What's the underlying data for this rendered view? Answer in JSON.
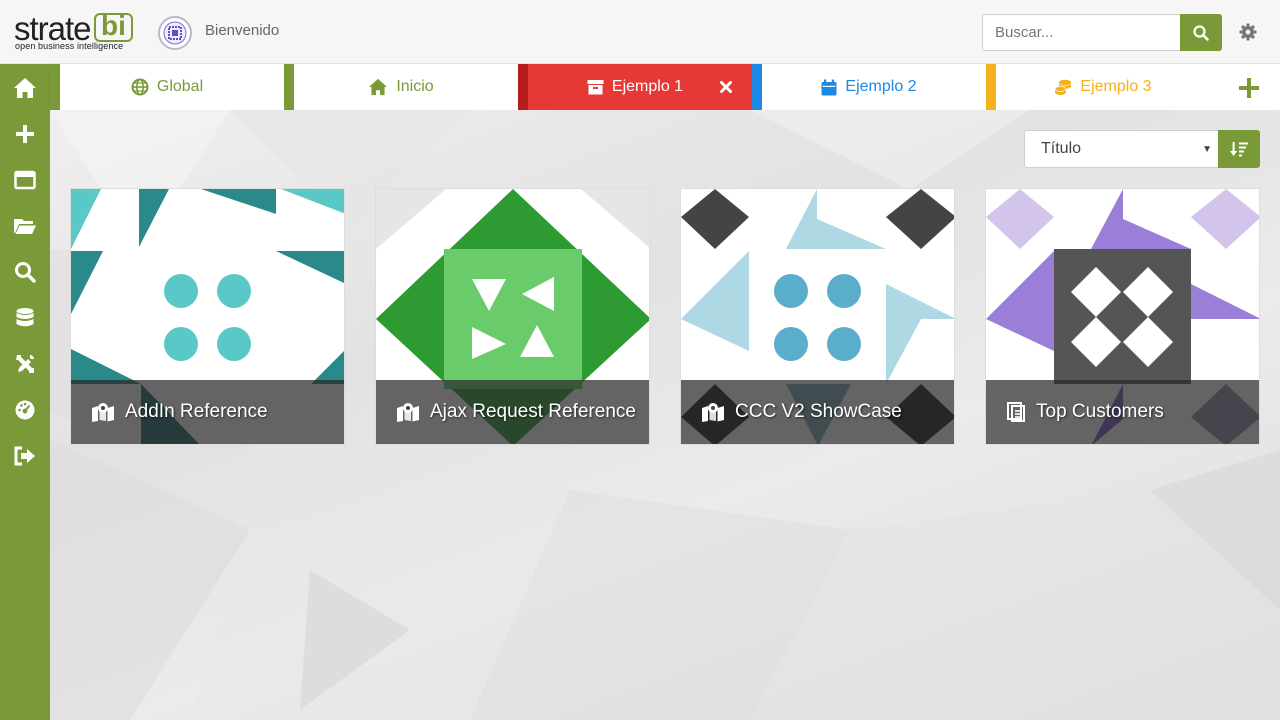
{
  "header": {
    "logo_word": "strate",
    "logo_bi": "bi",
    "logo_tagline": "open business intelligence",
    "welcome": "Bienvenido",
    "search_placeholder": "Buscar...",
    "accent": "#7a9a3a"
  },
  "sidebar": {
    "items": [
      {
        "icon": "home-icon"
      },
      {
        "icon": "plus-icon"
      },
      {
        "icon": "window-icon"
      },
      {
        "icon": "folder-open-icon"
      },
      {
        "icon": "search-icon"
      },
      {
        "icon": "database-icon"
      },
      {
        "icon": "tools-icon"
      },
      {
        "icon": "dashboard-gauge-icon"
      },
      {
        "icon": "logout-icon"
      }
    ]
  },
  "tabs": [
    {
      "label": "Global",
      "icon": "globe-icon",
      "color": "#7a9a3a",
      "active": false
    },
    {
      "label": "Inicio",
      "icon": "home-icon",
      "color": "#7a9a3a",
      "active": false
    },
    {
      "label": "Ejemplo 1",
      "icon": "archive-icon",
      "color": "#e53935",
      "active": true
    },
    {
      "label": "Ejemplo 2",
      "icon": "calendar-icon",
      "color": "#1e88e5",
      "active": false
    },
    {
      "label": "Ejemplo 3",
      "icon": "coins-icon",
      "color": "#f5b11b",
      "active": false
    }
  ],
  "sort": {
    "selected": "Título"
  },
  "cards": [
    {
      "title": "AddIn Reference",
      "icon": "map-marker-icon",
      "color": "#2a8a8a"
    },
    {
      "title": "Ajax Request Reference",
      "icon": "map-marker-icon",
      "color": "#2e9a32"
    },
    {
      "title": "CCC V2 ShowCase",
      "icon": "map-marker-icon",
      "color": "#5aaecc"
    },
    {
      "title": "Top Customers",
      "icon": "report-icon",
      "color": "#9b7ed8"
    }
  ]
}
